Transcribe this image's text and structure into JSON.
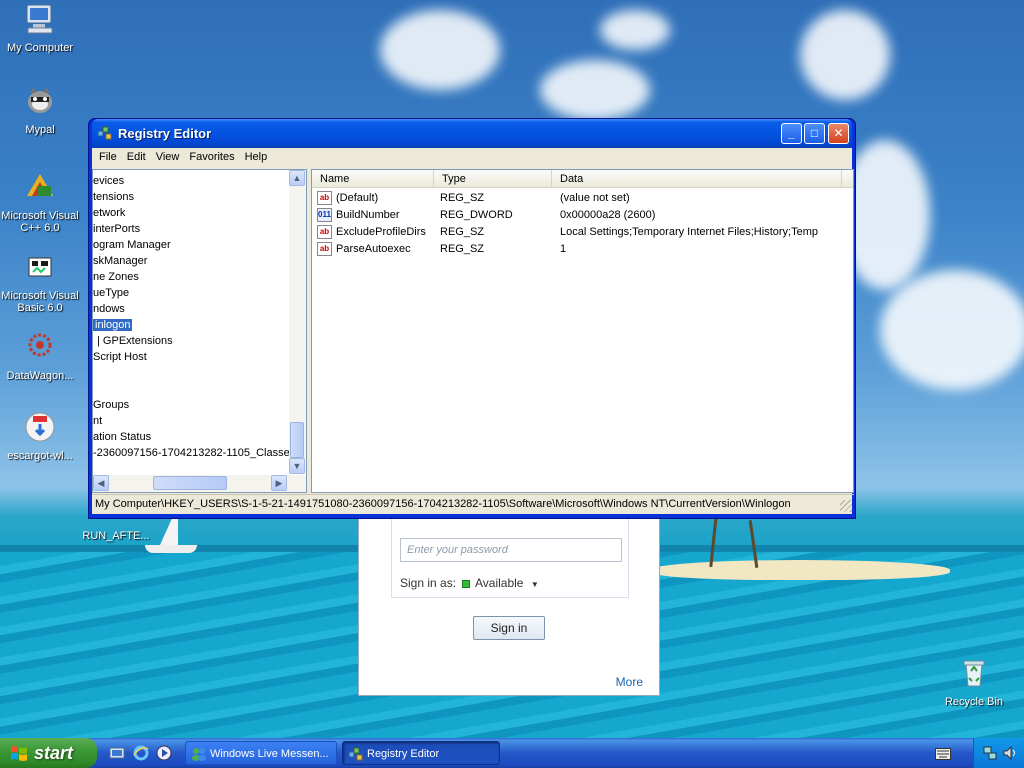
{
  "desktop": {
    "icons": [
      {
        "label": "My Computer",
        "icon": "my-computer-icon"
      },
      {
        "label": "Mypal",
        "icon": "raccoon-browser-icon"
      },
      {
        "label": "Microsoft Visual C++ 6.0",
        "icon": "visual-cpp-icon"
      },
      {
        "label": "Microsoft Visual Basic 6.0",
        "icon": "visual-basic-icon"
      },
      {
        "label": "DataWagon...",
        "icon": "datawagon-icon"
      },
      {
        "label": "escargot-wl...",
        "icon": "escargot-installer-icon"
      },
      {
        "label": "RUN_AFTE...",
        "icon": "file-icon"
      },
      {
        "label": "Recycle Bin",
        "icon": "recycle-bin-icon"
      }
    ]
  },
  "messenger": {
    "password_placeholder": "Enter your password",
    "sign_in_as_label": "Sign in as:",
    "status_label": "Available",
    "status_color": "#33bb33",
    "sign_in_button": "Sign in",
    "more_link": "More"
  },
  "regedit": {
    "title": "Registry Editor",
    "menu": [
      "File",
      "Edit",
      "View",
      "Favorites",
      "Help"
    ],
    "tree_items": [
      "evices",
      "tensions",
      "etwork",
      "interPorts",
      "ogram Manager",
      "skManager",
      "ne Zones",
      "ueType",
      "ndows",
      "inlogon",
      "GPExtensions",
      "Script Host",
      "",
      "",
      "Groups",
      "nt",
      "ation Status",
      "-2360097156-1704213282-1105_Classe"
    ],
    "selected_tree_index": 9,
    "columns": [
      "Name",
      "Type",
      "Data"
    ],
    "values": [
      {
        "name": "(Default)",
        "type": "REG_SZ",
        "data": "(value not set)",
        "icon": "ab-string-icon"
      },
      {
        "name": "BuildNumber",
        "type": "REG_DWORD",
        "data": "0x00000a28 (2600)",
        "icon": "binary-value-icon"
      },
      {
        "name": "ExcludeProfileDirs",
        "type": "REG_SZ",
        "data": "Local Settings;Temporary Internet Files;History;Temp",
        "icon": "ab-string-icon"
      },
      {
        "name": "ParseAutoexec",
        "type": "REG_SZ",
        "data": "1",
        "icon": "ab-string-icon"
      }
    ],
    "status_path": "My Computer\\HKEY_USERS\\S-1-5-21-1491751080-2360097156-1704213282-1105\\Software\\Microsoft\\Windows NT\\CurrentVersion\\Winlogon"
  },
  "taskbar": {
    "start_label": "start",
    "tasks": [
      {
        "label": "Windows Live Messen...",
        "icon": "messenger-icon",
        "active": false
      },
      {
        "label": "Registry Editor",
        "icon": "regedit-icon",
        "active": true
      }
    ],
    "quick_launch": [
      "show-desktop-icon",
      "internet-explorer-icon",
      "media-player-icon"
    ]
  },
  "colors": {
    "xp_title_blue": "#0453e0",
    "selection_blue": "#316ac5",
    "start_green": "#3c9a37"
  }
}
